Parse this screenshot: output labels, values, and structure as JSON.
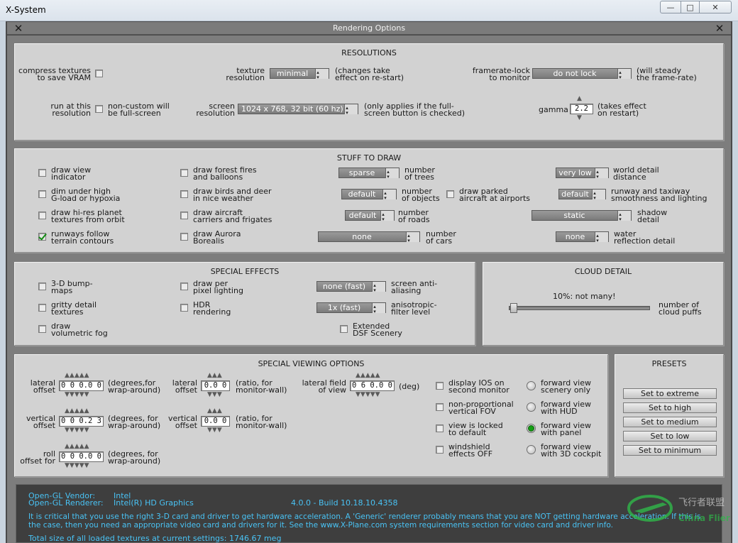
{
  "window": {
    "app_title": "X-System",
    "min_label": "—",
    "max_label": "□",
    "close_label": "✕"
  },
  "dialog": {
    "title": "Rendering Options",
    "close_glyph": "✕"
  },
  "resolutions": {
    "title": "RESOLUTIONS",
    "compress_l1": "compress textures",
    "compress_l2": "to save VRAM",
    "texres_l1": "texture",
    "texres_l2": "resolution",
    "texres_value": "minimal",
    "texres_n1": "(changes take",
    "texres_n2": "effect on re-start)",
    "framelock_l1": "framerate-lock",
    "framelock_l2": "to monitor",
    "framelock_value": "do not lock",
    "framelock_n1": "(will steady",
    "framelock_n2": "the frame-rate)",
    "runat_l1": "run at this",
    "runat_l2": "resolution",
    "noncustom_l1": "non-custom will",
    "noncustom_l2": "be full-screen",
    "screenres_l1": "screen",
    "screenres_l2": "resolution",
    "screenres_value": "1024 x 768, 32 bit (60 hz)",
    "screenres_n1": "(only applies if the full-",
    "screenres_n2": "screen button is checked)",
    "gamma_label": "gamma",
    "gamma_value": "2.2",
    "gamma_n1": "(takes effect",
    "gamma_n2": "on restart)"
  },
  "stuff": {
    "title": "STUFF TO DRAW",
    "c1": [
      {
        "l1": "draw view",
        "l2": "indicator",
        "checked": false
      },
      {
        "l1": "dim under high",
        "l2": "G-load or hypoxia",
        "checked": false
      },
      {
        "l1": "draw hi-res planet",
        "l2": "textures from orbit",
        "checked": false
      },
      {
        "l1": "runways follow",
        "l2": "terrain contours",
        "checked": true
      }
    ],
    "c2": [
      {
        "l1": "draw forest fires",
        "l2": "and balloons",
        "checked": false
      },
      {
        "l1": "draw birds and deer",
        "l2": "in nice weather",
        "checked": false
      },
      {
        "l1": "draw aircraft",
        "l2": "carriers and frigates",
        "checked": false
      },
      {
        "l1": "draw Aurora",
        "l2": "Borealis",
        "checked": false
      }
    ],
    "trees": {
      "value": "sparse",
      "l1": "number",
      "l2": "of trees"
    },
    "objects": {
      "value": "default",
      "l1": "number",
      "l2": "of objects"
    },
    "roads": {
      "value": "default",
      "l1": "number",
      "l2": "of roads"
    },
    "cars": {
      "value": "none",
      "l1": "number",
      "l2": "of cars"
    },
    "parked": {
      "l1": "draw parked",
      "l2": "aircraft at airports"
    },
    "world": {
      "value": "very low",
      "l1": "world detail",
      "l2": "distance"
    },
    "runway": {
      "value": "default",
      "l1": "runway and taxiway",
      "l2": "smoothness and lighting"
    },
    "shadow": {
      "value": "static",
      "l1": "shadow",
      "l2": "detail"
    },
    "water": {
      "value": "none",
      "l1": "water",
      "l2": "reflection detail"
    }
  },
  "effects": {
    "title": "SPECIAL EFFECTS",
    "bump_l1": "3-D bump-",
    "bump_l2": "maps",
    "gritty_l1": "gritty detail",
    "gritty_l2": "textures",
    "fog_l1": "draw",
    "fog_l2": "volumetric fog",
    "perpix_l1": "draw per",
    "perpix_l2": "pixel lighting",
    "hdr_l1": "HDR",
    "hdr_l2": "rendering",
    "aa_value": "none (fast)",
    "aa_l1": "screen anti-",
    "aa_l2": "aliasing",
    "aniso_value": "1x (fast)",
    "aniso_l1": "anisotropic-",
    "aniso_l2": "filter level",
    "dsf_l1": "Extended",
    "dsf_l2": "DSF Scenery"
  },
  "cloud": {
    "title": "CLOUD DETAIL",
    "slider_text": "10%: not many!",
    "slider_level": 0.1,
    "l1": "number of",
    "l2": "cloud puffs"
  },
  "viewing": {
    "title": "SPECIAL VIEWING OPTIONS",
    "lat_l1": "lateral",
    "lat_l2": "offset",
    "lat_value": "0 0 0.0 0",
    "lat_n1": "(degrees,for",
    "lat_n2": "wrap-around)",
    "vert_l1": "vertical",
    "vert_l2": "offset",
    "vert_value": "0 0 0.2 3",
    "vert_n1": "(degrees, for",
    "vert_n2": "wrap-around)",
    "roll_l1": "roll",
    "roll_l2": "offset for",
    "roll_value": "0 0 0.0 0",
    "roll_n1": "(degrees, for",
    "roll_n2": "wrap-around)",
    "latr_l1": "lateral",
    "latr_l2": "offset",
    "latr_value": "0.0 0",
    "latr_n1": "(ratio, for",
    "latr_n2": "monitor-wall)",
    "vertr_l1": "vertical",
    "vertr_l2": "offset",
    "vertr_value": "0.0 0",
    "vertr_n1": "(ratio, for",
    "vertr_n2": "monitor-wall)",
    "fov_l1": "lateral field",
    "fov_l2": "of view",
    "fov_value": "0 6 0.0 0",
    "fov_unit": "(deg)",
    "checks": [
      {
        "l1": "display IOS on",
        "l2": "second monitor"
      },
      {
        "l1": "non-proportional",
        "l2": "vertical FOV"
      },
      {
        "l1": "view is locked",
        "l2": "to default"
      },
      {
        "l1": "windshield",
        "l2": "effects OFF"
      }
    ],
    "radios": [
      {
        "l1": "forward view",
        "l2": "scenery only",
        "selected": false
      },
      {
        "l1": "forward view",
        "l2": "with HUD",
        "selected": false
      },
      {
        "l1": "forward view",
        "l2": "with panel",
        "selected": true
      },
      {
        "l1": "forward view",
        "l2": "with 3D cockpit",
        "selected": false
      }
    ]
  },
  "presets": {
    "title": "PRESETS",
    "buttons": [
      "Set to extreme",
      "Set to high",
      "Set to medium",
      "Set to low",
      "Set to minimum"
    ]
  },
  "info": {
    "vendor_label": "Open-GL Vendor:",
    "vendor_value": "Intel",
    "renderer_label": "Open-GL Renderer:",
    "renderer_value": "Intel(R) HD Graphics",
    "build": "4.0.0 - Build 10.18.10.4358",
    "warn1": "It is critical that you use the right 3-D card and driver to get hardware acceleration. A 'Generic' renderer probably means that you are NOT getting hardware acceleration. If this is",
    "warn2": "the case, then you need an appropriate video card and drivers for it. See the www.X-Plane.com system requirements section for video card and driver info.",
    "total": "Total size of all loaded textures at current settings: 1746.67 meg"
  },
  "watermark": {
    "text_cn": "飞行者联盟",
    "text_en": "China Flier"
  }
}
